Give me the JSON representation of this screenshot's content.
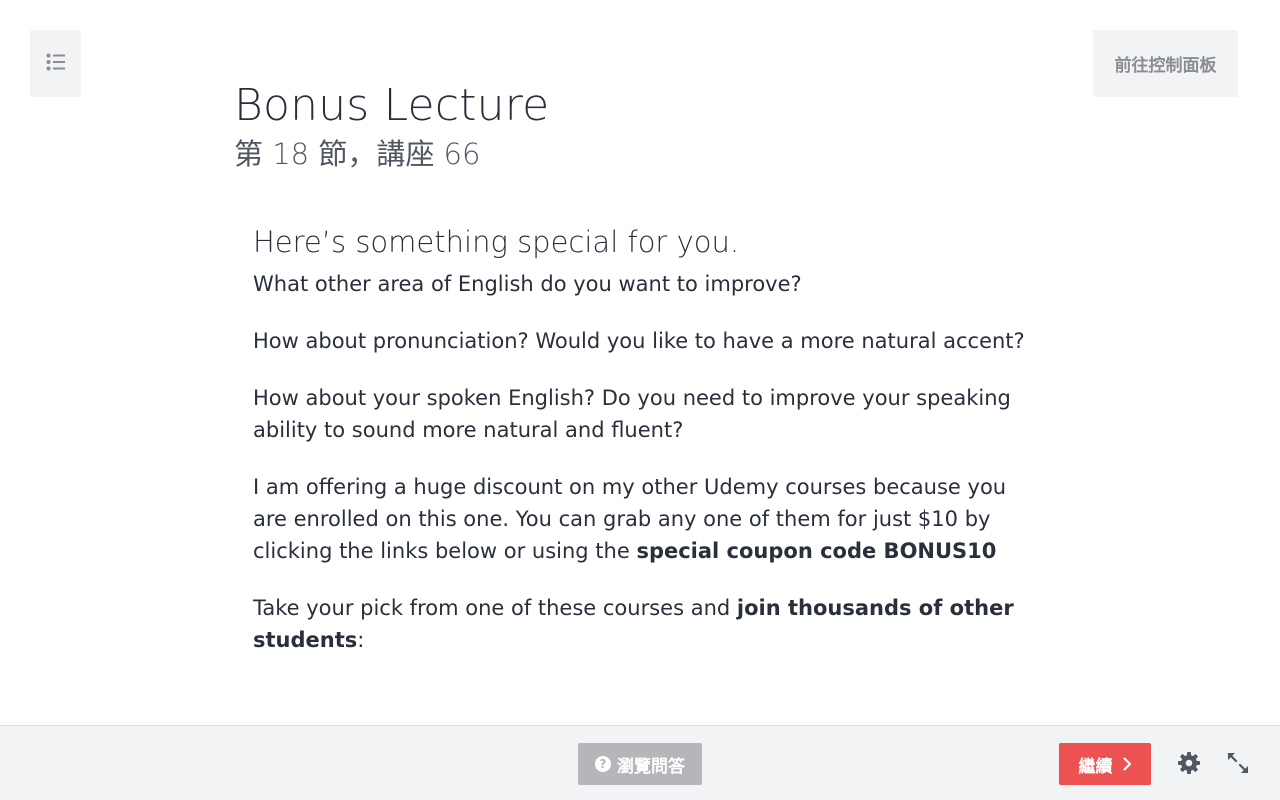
{
  "curriculum_toggle": {
    "icon": "list-icon"
  },
  "dashboard_button": {
    "label": "前往控制面板"
  },
  "lecture": {
    "title": "Bonus Lecture",
    "subtitle": "第 18 節，講座 66"
  },
  "article": {
    "heading": "Here’s something special for you.",
    "p1": "What other area of English do you want to improve?",
    "p2": "How about pronunciation? Would you like to have a more natural accent?",
    "p3": "How about your spoken English? Do you need to improve your speaking ability to sound more natural and fluent?",
    "p4_text": "I am offering a huge discount on my other Udemy courses because you are enrolled on this one. You can grab any one of them for just $10 by clicking the links below or using the ",
    "p4_bold": "special coupon code BONUS10",
    "p5_text": "Take your pick from one of these courses and ",
    "p5_bold": "join thousands of other students",
    "p5_tail": ":"
  },
  "footer": {
    "qa_button": {
      "label": "瀏覽問答",
      "icon": "question-circle-icon"
    },
    "continue_button": {
      "label": "繼續",
      "icon": "chevron-right-icon"
    },
    "settings_icon": "gear-icon",
    "expand_icon": "expand-icon"
  },
  "colors": {
    "accent": "#ec5252",
    "footer_bg": "#f2f3f5",
    "disabled_button": "#b4b6b9",
    "text": "#29303b"
  }
}
